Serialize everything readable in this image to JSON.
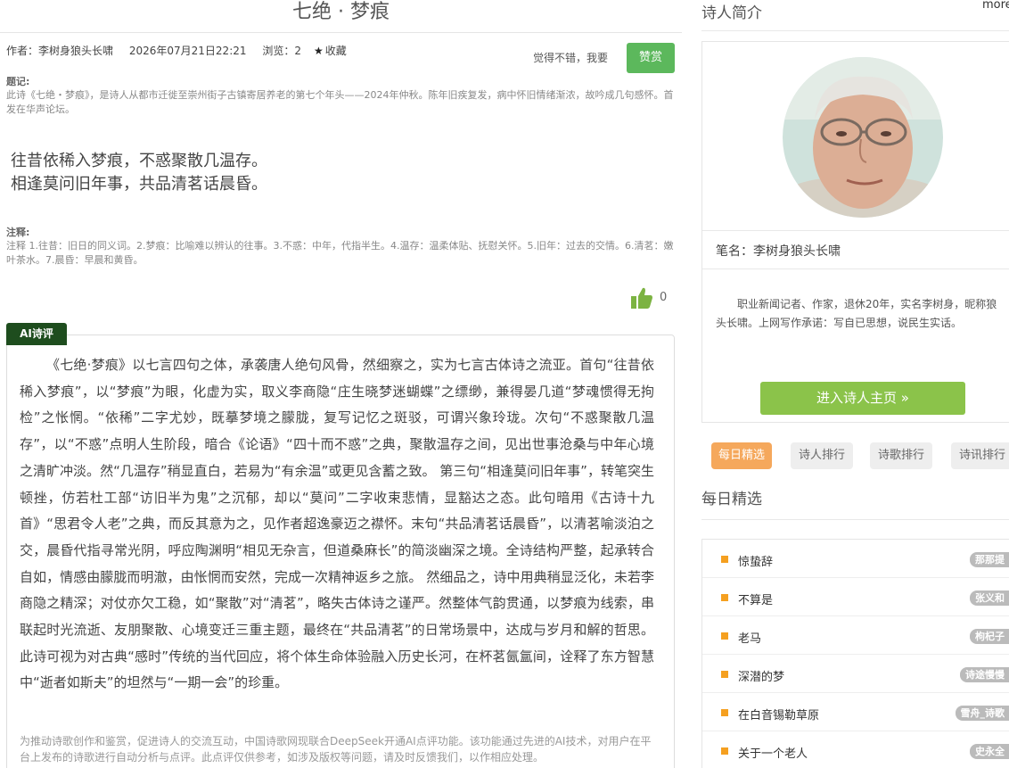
{
  "poem": {
    "title": "七绝 · 梦痕",
    "author": "作者：李树身狼头长啸",
    "date": "2026年07月21日22:21",
    "views": "浏览：2",
    "favorite": "收藏",
    "praise_prompt": "觉得不错，我要",
    "praise_button": "赞赏",
    "preface_label": "题记:",
    "preface_text": "此诗《七绝・梦痕》，是诗人从都市迁徙至崇州街子古镇寄居养老的第七个年头——2024年仲秋。陈年旧疾复发，病中怀旧情绪渐浓，故吟成几句感怀。首发在华声论坛。",
    "lines": [
      "往昔依稀入梦痕，不惑聚散几温存。",
      "相逢莫问旧年事，共品清茗话晨昏。"
    ],
    "notes_label": "注释:",
    "notes_text": "注释 1.往昔：旧日的同义词。2.梦痕：比喻难以辨认的往事。3.不惑：中年，代指半生。4.温存：温柔体贴、抚慰关怀。5.旧年：过去的交情。6.清茗：嫩叶茶水。7.晨昏：早晨和黄昏。",
    "like_count": "0"
  },
  "ai_review": {
    "tag": "AI诗评",
    "text": "《七绝·梦痕》以七言四句之体，承袭唐人绝句风骨，然细察之，实为七言古体诗之流亚。首句“往昔依稀入梦痕”，以“梦痕”为眼，化虚为实，取义李商隐“庄生晓梦迷蝴蝶”之缥缈，兼得晏几道“梦魂惯得无拘检”之怅惘。“依稀”二字尤妙，既摹梦境之朦胧，复写记忆之斑驳，可谓兴象玲珑。次句“不惑聚散几温存”，以“不惑”点明人生阶段，暗合《论语》“四十而不惑”之典，聚散温存之间，见出世事沧桑与中年心境之清旷冲淡。然“几温存”稍显直白，若易为“有余温”或更见含蓄之致。 第三句“相逢莫问旧年事”，转笔突生顿挫，仿若杜工部“访旧半为鬼”之沉郁，却以“莫问”二字收束悲情，显豁达之态。此句暗用《古诗十九首》“思君令人老”之典，而反其意为之，见作者超逸豪迈之襟怀。末句“共品清茗话晨昏”，以清茗喻淡泊之交，晨昏代指寻常光阴，呼应陶渊明“相见无杂言，但道桑麻长”的简淡幽深之境。全诗结构严整，起承转合自如，情感由朦胧而明澈，由怅惘而安然，完成一次精神返乡之旅。 然细品之，诗中用典稍显泛化，未若李商隐之精深；对仗亦欠工稳，如“聚散”对“清茗”，略失古体诗之谨严。然整体气韵贯通，以梦痕为线索，串联起时光流逝、友朋聚散、心境变迁三重主题，最终在“共品清茗”的日常场景中，达成与岁月和解的哲思。此诗可视为对古典“感时”传统的当代回应，将个体生命体验融入历史长河，在杯茗氤氲间，诠释了东方智慧中“逝者如斯夫”的坦然与“一期一会”的珍重。",
    "disclaimer": "为推动诗歌创作和鉴赏，促进诗人的交流互动，中国诗歌网现联合DeepSeek开通AI点评功能。该功能通过先进的AI技术，对用户在平台上发布的诗歌进行自动分析与点评。此点评仅供参考，如涉及版权等问题，请及时反馈我们，以作相应处理。"
  },
  "sidebar": {
    "section_title": "诗人简介",
    "more": "more",
    "pen_name": "笔名：李树身狼头长啸",
    "bio": "职业新闻记者、作家，退休20年，实名李树身，昵称狼头长啸。上网写作承诺：写自已思想，说民生实话。",
    "enter_button": "进入诗人主页 »",
    "tabs": [
      "每日精选",
      "诗人排行",
      "诗歌排行",
      "诗讯排行"
    ],
    "daily_title": "每日精选",
    "daily_items": [
      {
        "title": "惊蛰辞",
        "author": "那那提"
      },
      {
        "title": "不算是",
        "author": "张义和"
      },
      {
        "title": "老马",
        "author": "枸杞子"
      },
      {
        "title": "深潜的梦",
        "author": "诗途慢慢"
      },
      {
        "title": "在白音锡勒草原",
        "author": "雪舟_诗歌"
      },
      {
        "title": "关于一个老人",
        "author": "史永全"
      }
    ]
  },
  "colors": {
    "praise_green": "#5cb85c",
    "enter_green": "#8bc34a",
    "active_tab": "#f5a85c",
    "ai_tag": "#1e4d1e",
    "list_square": "#f5a020"
  }
}
